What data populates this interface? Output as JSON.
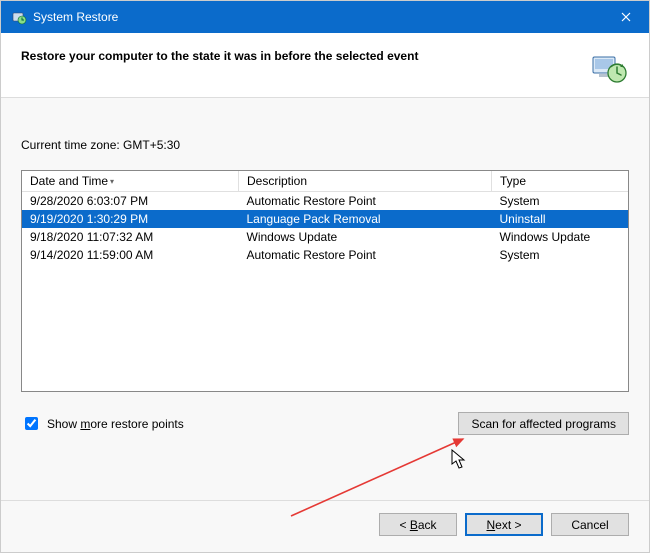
{
  "window": {
    "title": "System Restore"
  },
  "header": {
    "text": "Restore your computer to the state it was in before the selected event"
  },
  "timezone_label": "Current time zone: GMT+5:30",
  "table": {
    "columns": {
      "date": "Date and Time",
      "description": "Description",
      "type": "Type"
    },
    "rows": [
      {
        "date": "9/28/2020 6:03:07 PM",
        "description": "Automatic Restore Point",
        "type": "System",
        "selected": false
      },
      {
        "date": "9/19/2020 1:30:29 PM",
        "description": "Language Pack Removal",
        "type": "Uninstall",
        "selected": true
      },
      {
        "date": "9/18/2020 11:07:32 AM",
        "description": "Windows Update",
        "type": "Windows Update",
        "selected": false
      },
      {
        "date": "9/14/2020 11:59:00 AM",
        "description": "Automatic Restore Point",
        "type": "System",
        "selected": false
      }
    ]
  },
  "checkbox": {
    "prefix": "Show ",
    "underline": "m",
    "suffix": "ore restore points",
    "checked": true
  },
  "buttons": {
    "scan": "Scan for affected programs",
    "back": "< Back",
    "back_u": "B",
    "next": "Next >",
    "next_u": "N",
    "cancel": "Cancel"
  }
}
